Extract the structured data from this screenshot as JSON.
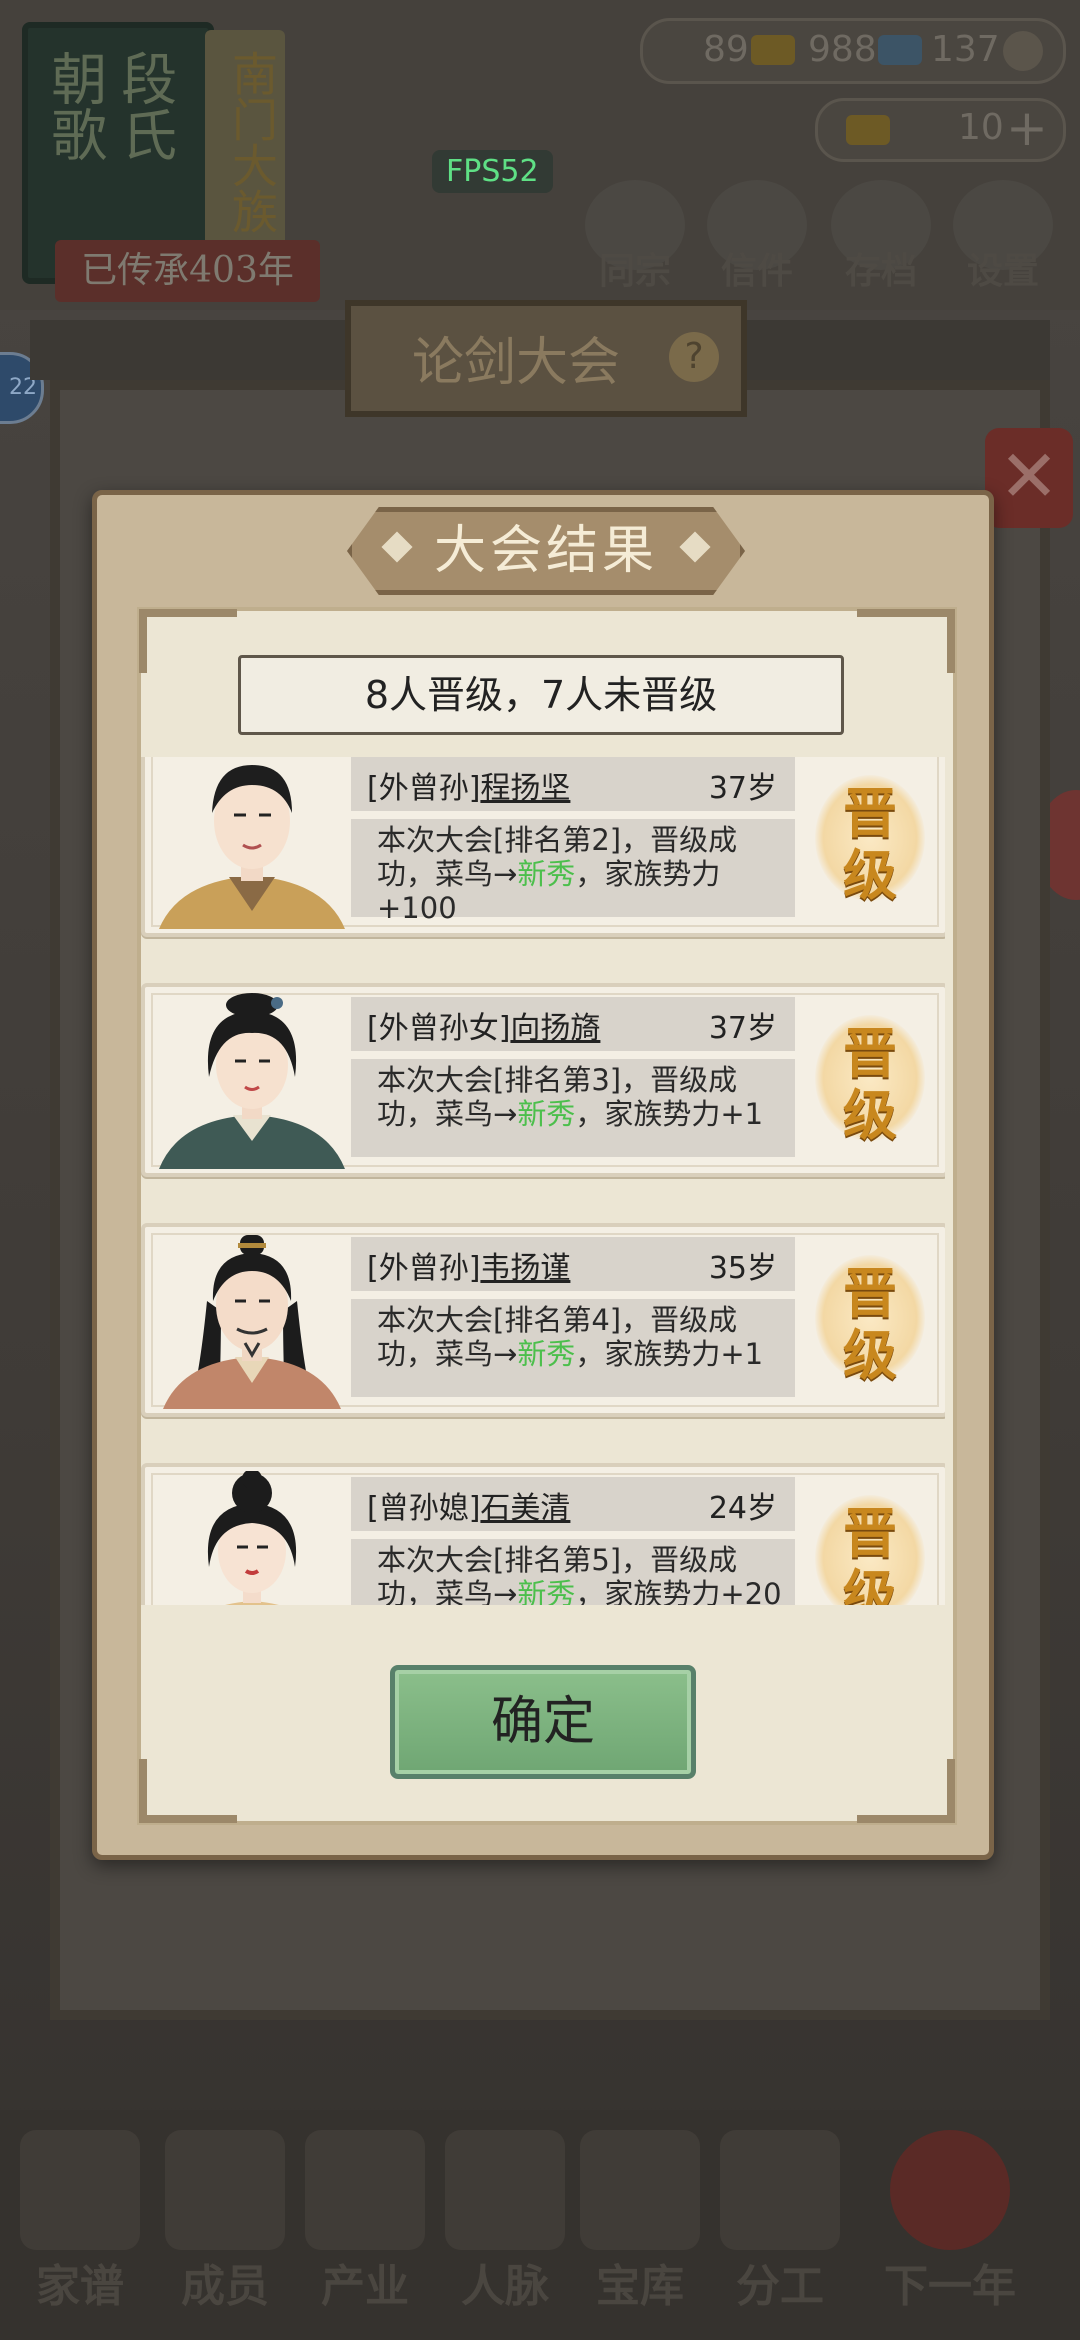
{
  "background": {
    "family_book": {
      "col1": "朝歌",
      "col2": "段氏"
    },
    "book_scroll": "南门大族",
    "heritage": "已传承403年",
    "fps": "FPS52",
    "resources": {
      "r1": "89",
      "r2": "988",
      "r3": "137"
    },
    "gold": "10",
    "top_buttons": [
      "同宗",
      "信件",
      "存档",
      "设置"
    ],
    "level_badge": "22",
    "hall_title": "论剑大会",
    "hall_help": "?",
    "close": "✕",
    "bottom_nav": [
      "家谱",
      "成员",
      "产业",
      "人脉",
      "宝库",
      "分工",
      "下一年"
    ]
  },
  "modal": {
    "title": "大会结果",
    "summary": "8人晋级，7人未晋级",
    "confirm": "确定",
    "entries": [
      {
        "relation": "[外曾孙]",
        "name": "程扬坚",
        "age": "37岁",
        "desc_a": "本次大会[排名第2]，晋级成功，菜鸟→",
        "rank_new": "新秀",
        "desc_b": "，家族势力+100",
        "badge1": "晋",
        "badge2": "级"
      },
      {
        "relation": "[外曾孙女]",
        "name": "向扬旖",
        "age": "37岁",
        "desc_a": "本次大会[排名第3]，晋级成功，菜鸟→",
        "rank_new": "新秀",
        "desc_b": "，家族势力+1",
        "badge1": "晋",
        "badge2": "级"
      },
      {
        "relation": "[外曾孙]",
        "name": "韦扬谨",
        "age": "35岁",
        "desc_a": "本次大会[排名第4]，晋级成功，菜鸟→",
        "rank_new": "新秀",
        "desc_b": "，家族势力+1",
        "badge1": "晋",
        "badge2": "级"
      },
      {
        "relation": "[曾孙媳]",
        "name": "石美清",
        "age": "24岁",
        "desc_a": "本次大会[排名第5]，晋级成功，菜鸟→",
        "rank_new": "新秀",
        "desc_b": "，家族势力+20",
        "badge1": "晋",
        "badge2": "级"
      }
    ]
  },
  "colors": {
    "accent_green": "#4cbf4c",
    "badge_gold": "#c8871e",
    "panel_frame": "#7a6448"
  }
}
